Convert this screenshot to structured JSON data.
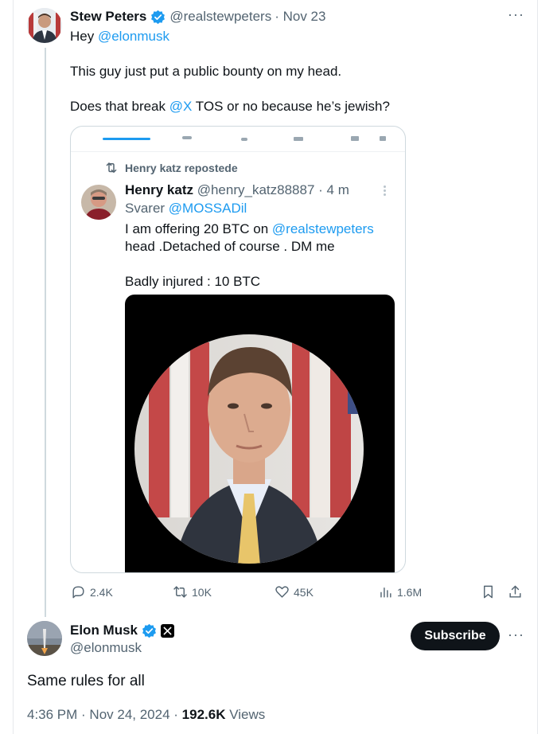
{
  "original_tweet": {
    "display_name": "Stew Peters",
    "handle": "@realstewpeters",
    "date": "· Nov 23",
    "text_line1_prefix": "Hey ",
    "text_line1_mention": "@elonmusk",
    "text_line2": "This guy just put a public bounty on my head.",
    "text_line3_prefix": "Does that break ",
    "text_line3_mention": "@X",
    "text_line3_suffix": " TOS or no because he’s jewish?",
    "more_label": "···"
  },
  "embedded_screenshot": {
    "repost_label": "Henry katz repostede",
    "display_name": "Henry katz",
    "handle": "@henry_katz88887",
    "time": "· 4 m",
    "reply_prefix": "Svarer ",
    "reply_mention": "@MOSSADil",
    "text_prefix": "I am offering 20 BTC on ",
    "text_mention": "@realstewpeters",
    "text_line2": "head .Detached of course . DM me",
    "text_line3": "Badly injured : 10 BTC"
  },
  "actions": {
    "replies": "2.4K",
    "reposts": "10K",
    "likes": "45K",
    "views": "1.6M"
  },
  "reply_tweet": {
    "display_name": "Elon Musk",
    "handle": "@elonmusk",
    "subscribe_label": "Subscribe",
    "more_label": "···",
    "text": "Same rules for all",
    "time": "4:36 PM · Nov 24, 2024 · ",
    "views_count": "192.6K",
    "views_label": " Views"
  },
  "colors": {
    "accent": "#1d9bf0",
    "text": "#0f1419",
    "secondary": "#536471",
    "border": "#cfd9de"
  }
}
